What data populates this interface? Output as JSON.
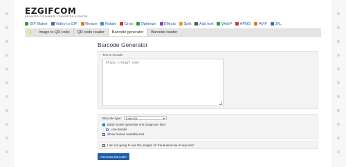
{
  "brand": {
    "logo": "EZGIFCOM",
    "tagline": "ANIMATED GIF MAKER, CONVERTER & EDITOR"
  },
  "topnav": [
    {
      "label": "GIF Maker",
      "icon": "gif-maker-icon",
      "color": "#2a9d3a"
    },
    {
      "label": "Video to GIF",
      "icon": "video-to-gif-icon",
      "color": "#3a6fc4"
    },
    {
      "label": "Resize",
      "icon": "resize-icon",
      "color": "#e07b1a"
    },
    {
      "label": "Rotate",
      "icon": "rotate-icon",
      "color": "#3a8fc4"
    },
    {
      "label": "Crop",
      "icon": "crop-icon",
      "color": "#c43a3a"
    },
    {
      "label": "Optimize",
      "icon": "optimize-icon",
      "color": "#2a9d3a"
    },
    {
      "label": "Effects",
      "icon": "effects-icon",
      "color": "#8a3ac4"
    },
    {
      "label": "Split",
      "icon": "split-icon",
      "color": "#e0a01a"
    },
    {
      "label": "Add text",
      "icon": "add-text-icon",
      "color": "#555555"
    },
    {
      "label": "WebP",
      "icon": "webp-icon",
      "color": "#2a9d3a"
    },
    {
      "label": "APNG",
      "icon": "apng-icon",
      "color": "#c43a3a"
    },
    {
      "label": "AVIF",
      "icon": "avif-icon",
      "color": "#e07b1a"
    },
    {
      "label": "JXL",
      "icon": "jxl-icon",
      "color": "#3a6fc4"
    }
  ],
  "subnav": {
    "tabs": [
      {
        "label": "Image to QR code",
        "active": false
      },
      {
        "label": "QR code reader",
        "active": false
      },
      {
        "label": "Barcode generator",
        "active": true
      },
      {
        "label": "Barcode reader",
        "active": false
      }
    ]
  },
  "page": {
    "title": "Barcode Generator"
  },
  "form": {
    "text_label": "Text to encode",
    "text_value": "https://ezgif.com/",
    "format_label": "Barcode type:",
    "format_value": "Code128",
    "options": [
      {
        "type": "checkbox",
        "checked": true,
        "label": "Batch mode (generate one image per line)"
      },
      {
        "type": "radio",
        "checked": true,
        "label": "Line breaks"
      },
      {
        "type": "checkbox",
        "checked": false,
        "label": "Show human readable text"
      }
    ],
    "terms_label": "I am not going to use the images for fraudulent use of any kind",
    "terms_checked": false,
    "submit_label": "Generate barcode!"
  },
  "colors": {
    "accent": "#1f5fa8",
    "link": "#2a5db0",
    "panel_bg": "#f3f3f3",
    "subnav_bg": "#e4e4e4"
  }
}
